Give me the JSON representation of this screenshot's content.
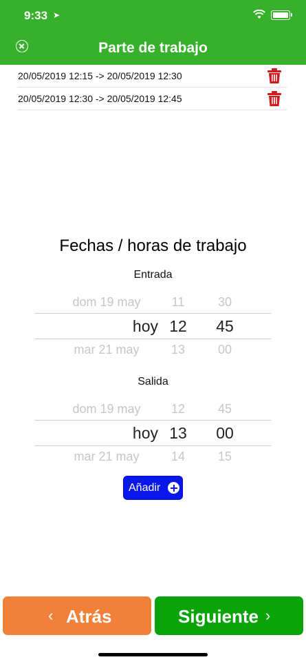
{
  "status": {
    "time": "9:33"
  },
  "header": {
    "title": "Parte de trabajo"
  },
  "entries": [
    {
      "text": "20/05/2019 12:15 -> 20/05/2019 12:30"
    },
    {
      "text": "20/05/2019 12:30 -> 20/05/2019 12:45"
    }
  ],
  "section_title": "Fechas / horas de trabajo",
  "entrada": {
    "label": "Entrada",
    "rows": [
      {
        "day": "dom 19 may",
        "hour": "11",
        "minute": "30"
      },
      {
        "day": "hoy",
        "hour": "12",
        "minute": "45"
      },
      {
        "day": "mar 21 may",
        "hour": "13",
        "minute": "00"
      }
    ]
  },
  "salida": {
    "label": "Salida",
    "rows": [
      {
        "day": "dom 19 may",
        "hour": "12",
        "minute": "45"
      },
      {
        "day": "hoy",
        "hour": "13",
        "minute": "00"
      },
      {
        "day": "mar 21 may",
        "hour": "14",
        "minute": "15"
      }
    ]
  },
  "add_button": {
    "label": "Añadir"
  },
  "footer": {
    "back_label": "Atrás",
    "next_label": "Siguiente"
  },
  "colors": {
    "header": "#37b12c",
    "back": "#f0813a",
    "next": "#0aa30a",
    "add": "#0a17ea",
    "trash": "#d3171a"
  }
}
